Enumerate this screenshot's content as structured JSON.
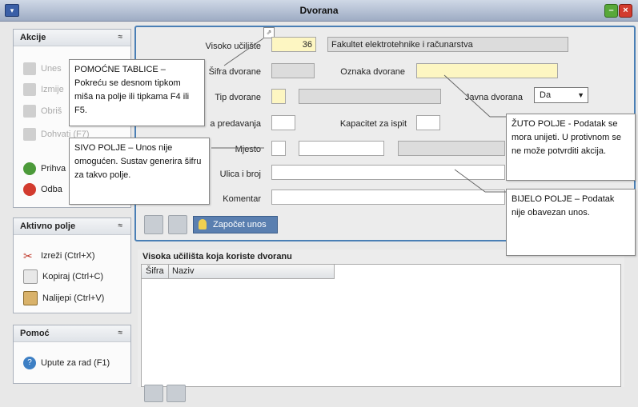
{
  "window": {
    "title": "Dvorana"
  },
  "sidebar": {
    "akcije": {
      "header": "Akcije",
      "items": [
        {
          "label": "Unes"
        },
        {
          "label": "Izmije"
        },
        {
          "label": "Obriš"
        },
        {
          "label": "Dohvati (F7)"
        },
        {
          "label": "Prihva"
        },
        {
          "label": "Odba"
        }
      ]
    },
    "aktivno_polje": {
      "header": "Aktivno polje",
      "items": [
        {
          "label": "Izreži (Ctrl+X)"
        },
        {
          "label": "Kopiraj (Ctrl+C)"
        },
        {
          "label": "Nalijepi (Ctrl+V)"
        }
      ]
    },
    "pomoc": {
      "header": "Pomoć",
      "items": [
        {
          "label": "Upute za rad (F1)"
        }
      ]
    }
  },
  "form": {
    "visoko_uciliste": {
      "label": "Visoko učilište",
      "code": "36",
      "name": "Fakultet elektrotehnike i računarstva"
    },
    "sifra_dvorane": {
      "label": "Šifra dvorane"
    },
    "oznaka_dvorane": {
      "label": "Oznaka dvorane"
    },
    "tip_dvorane": {
      "label": "Tip dvorane"
    },
    "javna_dvorana": {
      "label": "Javna dvorana",
      "value": "Da"
    },
    "kapacitet_predavanja": {
      "label": "a predavanja"
    },
    "kapacitet_ispit": {
      "label": "Kapacitet za ispit"
    },
    "mjesto": {
      "label": "Mjesto"
    },
    "ulica": {
      "label": "Ulica i broj"
    },
    "komentar": {
      "label": "Komentar"
    },
    "start_button": "Započet unos"
  },
  "list": {
    "title": "Visoka učilišta koja koriste dvoranu",
    "columns": [
      "Šifra",
      "Naziv"
    ]
  },
  "callouts": {
    "pomocne": "POMOĆNE TABLICE – Pokreću se desnom tipkom miša na polje ili tipkama F4 ili F5.",
    "sivo": "SIVO POLJE – Unos nije omogućen. Sustav generira šifru za takvo polje.",
    "zuto": "ŽUTO POLJE - Podatak se mora unijeti. U protivnom se ne može potvrditi akcija.",
    "bijelo": "BIJELO POLJE – Podatak nije obavezan unos."
  },
  "colors": {
    "frame_accent": "#4a7fb5",
    "required_field": "#fdf6c2",
    "disabled_field": "#dcdcdc"
  }
}
